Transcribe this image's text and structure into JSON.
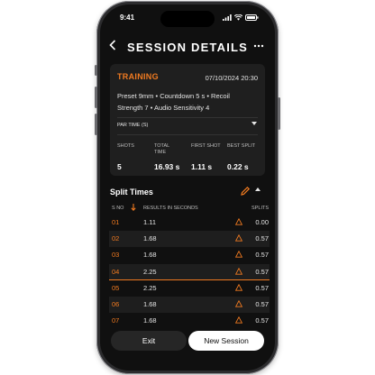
{
  "status_bar": {
    "time": "9:41"
  },
  "header": {
    "title": "SESSION DETAILS",
    "back_icon": "chevron-left-icon",
    "more_icon": "more-icon"
  },
  "session": {
    "tag": "TRAINING",
    "date": "07/10/2024 20:30",
    "preset_line1": "Preset 9mm  •  Countdown 5 s  •  Recoil",
    "preset_line2": "Strength 7  •  Audio Sensitivity 4",
    "par_time_label": "PAR TIME (S)",
    "stats": [
      {
        "label": "SHOTS",
        "value": "5"
      },
      {
        "label": "TOTAL TIME",
        "value": "16.93 s"
      },
      {
        "label": "FIRST SHOT",
        "value": "1.11 s"
      },
      {
        "label": "BEST SPLIT",
        "value": "0.22 s"
      }
    ]
  },
  "split_times": {
    "title": "Split Times",
    "columns": {
      "no": "S NO",
      "results": "RESULTS IN SECONDS",
      "splits": "SPLITS"
    },
    "rows": [
      {
        "no": "01",
        "result": "1.11",
        "split": "0.00"
      },
      {
        "no": "02",
        "result": "1.68",
        "split": "0.57"
      },
      {
        "no": "03",
        "result": "1.68",
        "split": "0.57"
      },
      {
        "no": "04",
        "result": "2.25",
        "split": "0.57"
      },
      {
        "no": "05",
        "result": "2.25",
        "split": "0.57"
      },
      {
        "no": "06",
        "result": "1.68",
        "split": "0.57"
      },
      {
        "no": "07",
        "result": "1.68",
        "split": "0.57"
      }
    ]
  },
  "actions": {
    "exit": "Exit",
    "new_session": "New Session"
  },
  "colors": {
    "accent": "#f07a20",
    "background": "#101010",
    "card": "#1f1f1f"
  }
}
